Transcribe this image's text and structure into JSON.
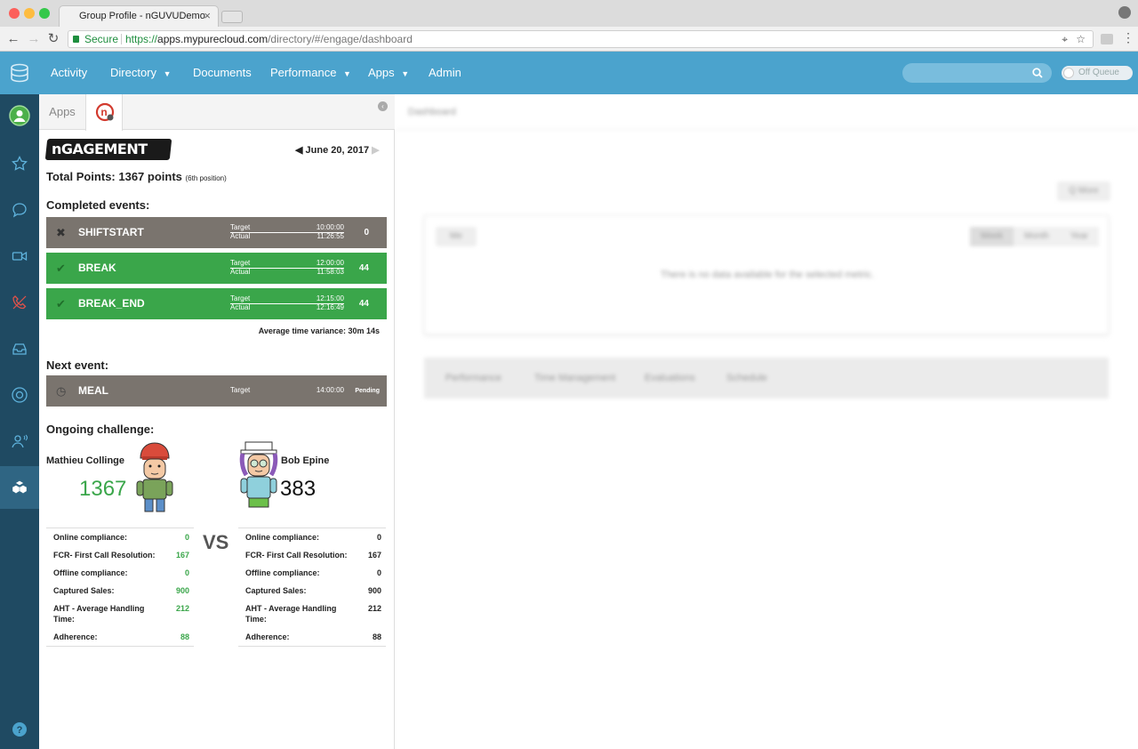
{
  "browser": {
    "tab_title": "Group Profile - nGUVUDemo",
    "secure_label": "Secure",
    "url_scheme": "https://",
    "url_host": "apps.mypurecloud.com",
    "url_path": "/directory/#/engage/dashboard"
  },
  "appbar": {
    "nav": [
      {
        "label": "Activity",
        "dropdown": false
      },
      {
        "label": "Directory",
        "dropdown": true
      },
      {
        "label": "Documents",
        "dropdown": false
      },
      {
        "label": "Performance",
        "dropdown": true
      },
      {
        "label": "Apps",
        "dropdown": true
      },
      {
        "label": "Admin",
        "dropdown": false
      }
    ],
    "search_placeholder": "",
    "status_toggle": "Off Queue",
    "colors": {
      "appbar": "#4ba3cd",
      "rail": "#1f4a62",
      "accent_green": "#3aa64a"
    }
  },
  "rail_icons": [
    "profile-avatar-icon",
    "star-icon",
    "chat-icon",
    "video-icon",
    "phone-icon",
    "inbox-icon",
    "lifebuoy-icon",
    "contacts-icon",
    "apps-cubes-icon",
    "help-icon"
  ],
  "panel": {
    "tabs": {
      "apps": "Apps"
    },
    "logo_text": "nGAGEMENT",
    "date": "June 20, 2017",
    "total_points_label": "Total Points: 1367 points",
    "position": "(6th position)",
    "completed_heading": "Completed events:",
    "events": [
      {
        "name": "SHIFTSTART",
        "status": "missed",
        "target_label": "Target",
        "actual_label": "Actual",
        "target": "10:00:00",
        "actual": "11:26:55",
        "points": "0"
      },
      {
        "name": "BREAK",
        "status": "done",
        "target_label": "Target",
        "actual_label": "Actual",
        "target": "12:00:00",
        "actual": "11:58:03",
        "points": "44"
      },
      {
        "name": "BREAK_END",
        "status": "done",
        "target_label": "Target",
        "actual_label": "Actual",
        "target": "12:15:00",
        "actual": "12:16:49",
        "points": "44"
      }
    ],
    "avg_variance": "Average time variance: 30m 14s",
    "next_heading": "Next event:",
    "next_event": {
      "name": "MEAL",
      "target_label": "Target",
      "target": "14:00:00",
      "status": "Pending"
    },
    "challenge_heading": "Ongoing challenge:",
    "vs": "VS",
    "player1": {
      "name": "Mathieu Collinge",
      "score": "1367",
      "stats": [
        {
          "label": "Online compliance:",
          "value": "0"
        },
        {
          "label": "FCR- First Call Resolution:",
          "value": "167"
        },
        {
          "label": "Offline compliance:",
          "value": "0"
        },
        {
          "label": "Captured Sales:",
          "value": "900"
        },
        {
          "label": "AHT - Average Handling Time:",
          "value": "212"
        },
        {
          "label": "Adherence:",
          "value": "88"
        }
      ]
    },
    "player2": {
      "name": "Bob Epine",
      "score": "383",
      "stats": [
        {
          "label": "Online compliance:",
          "value": "0"
        },
        {
          "label": "FCR- First Call Resolution:",
          "value": "167"
        },
        {
          "label": "Offline compliance:",
          "value": "0"
        },
        {
          "label": "Captured Sales:",
          "value": "900"
        },
        {
          "label": "AHT - Average Handling Time:",
          "value": "212"
        },
        {
          "label": "Adherence:",
          "value": "88"
        }
      ]
    }
  },
  "dashboard": {
    "breadcrumb": "Dashboard",
    "more_button": "Q More",
    "filter_button": "Me",
    "period_tabs": [
      "Week",
      "Month",
      "Year"
    ],
    "empty_message": "There is no data available for the selected metric.",
    "bottom_tabs": [
      "Performance",
      "Time Management",
      "Evaluations",
      "Schedule"
    ]
  }
}
